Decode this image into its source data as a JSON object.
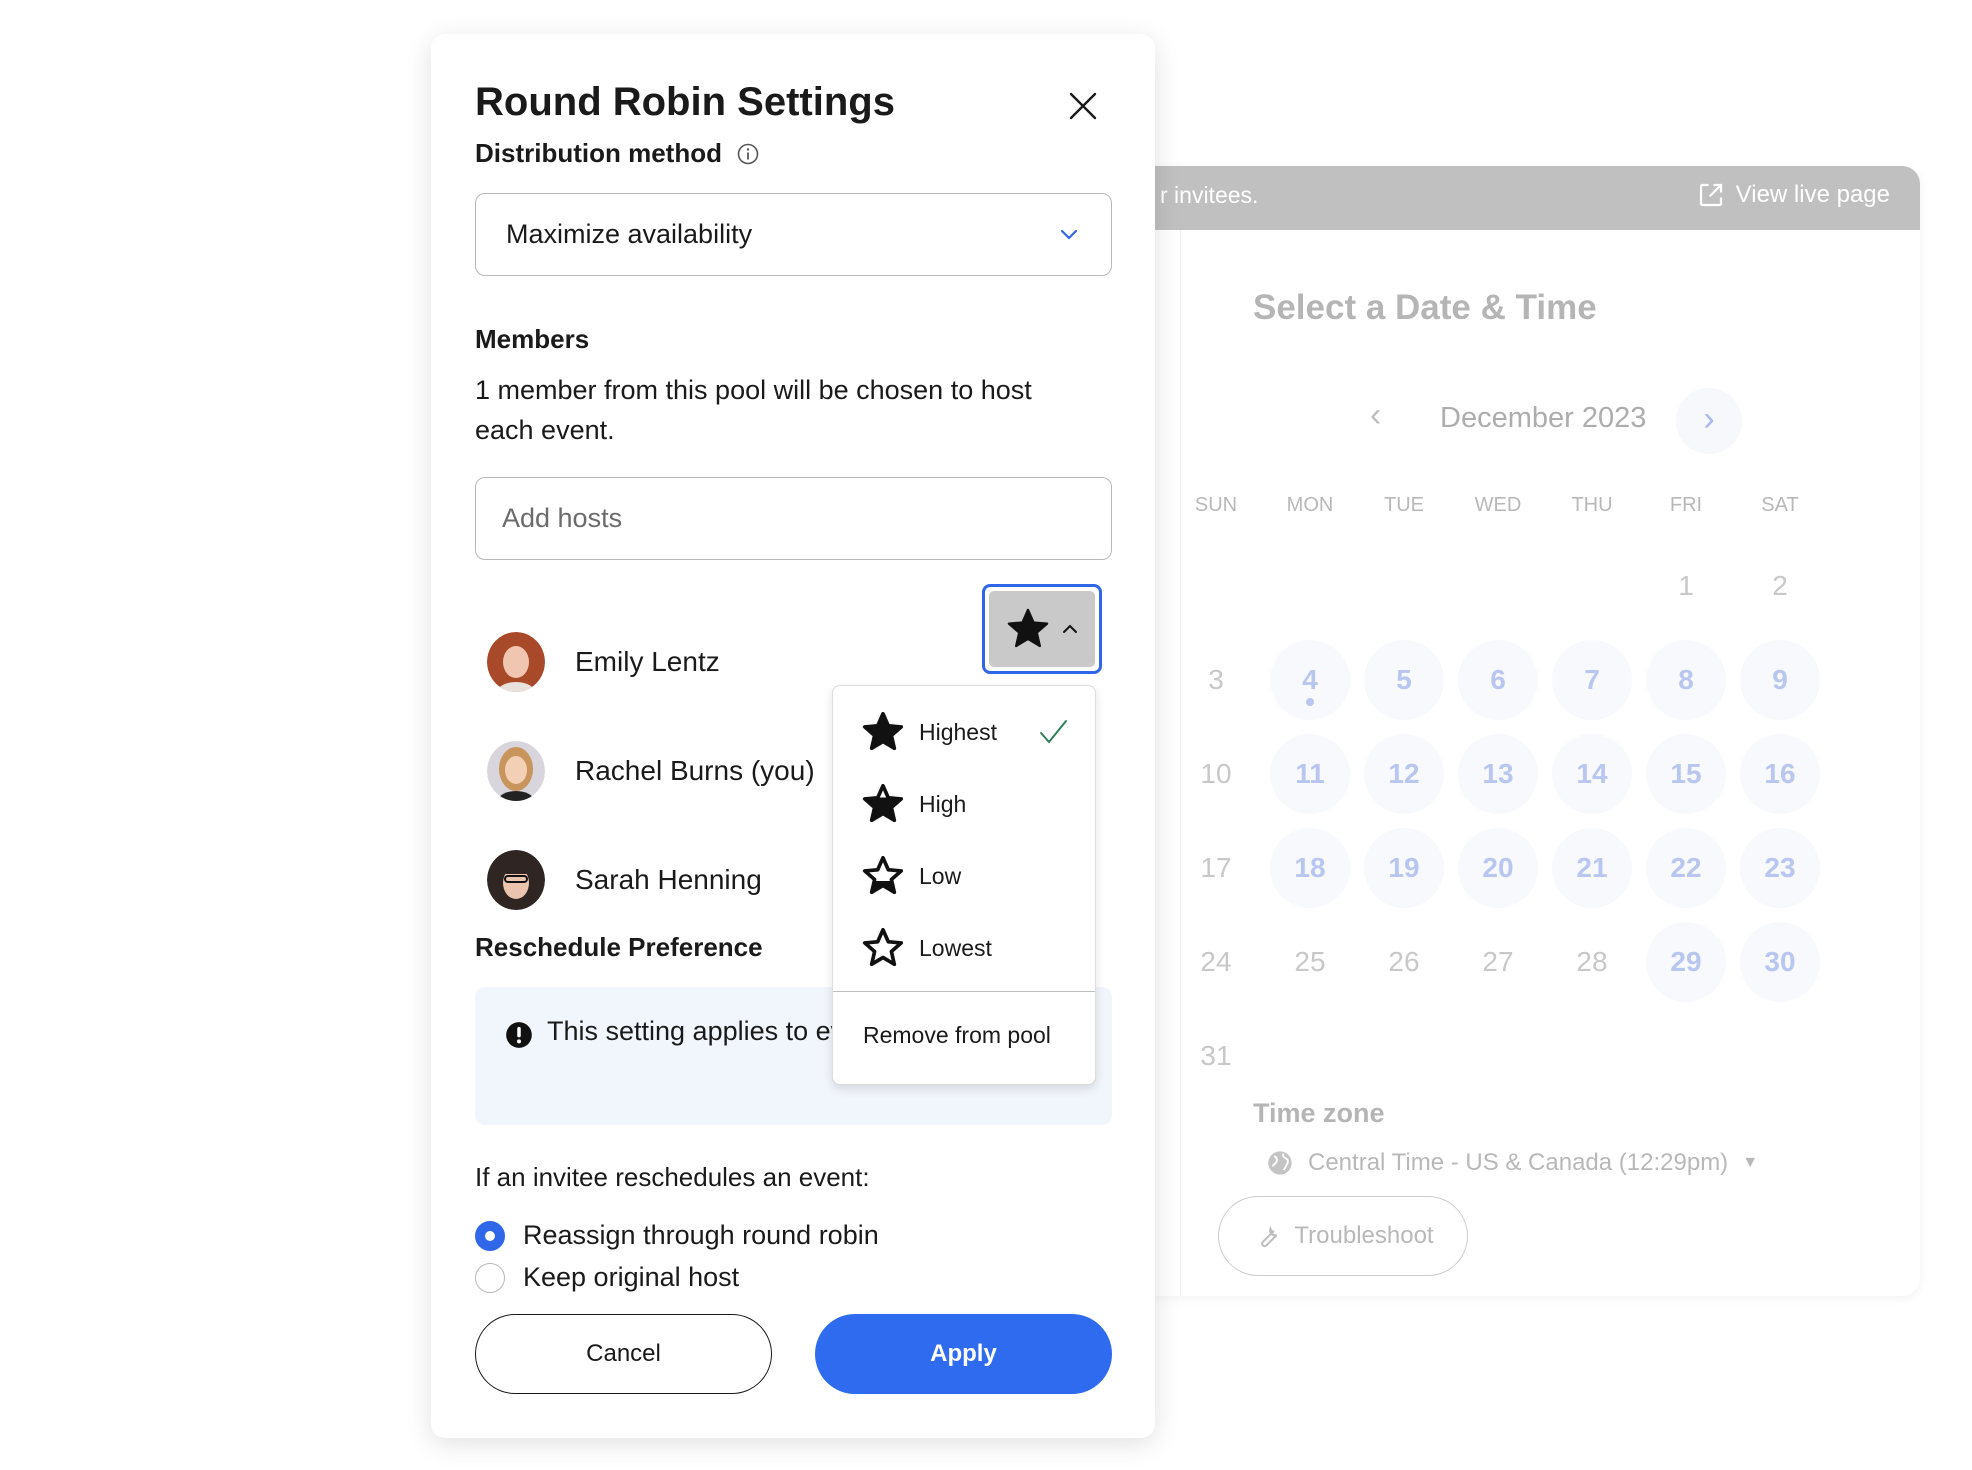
{
  "modal": {
    "title": "Round Robin Settings",
    "distribution_label": "Distribution method",
    "distribution_value": "Maximize availability",
    "members_label": "Members",
    "members_description": "1 member from this pool will be chosen to host each event.",
    "add_hosts_placeholder": "Add hosts",
    "members": [
      {
        "name": "Emily Lentz",
        "avatar_color": "#b5522e"
      },
      {
        "name": "Rachel Burns (you)",
        "avatar_color": "#c99a6a"
      },
      {
        "name": "Sarah Henning",
        "avatar_color": "#3a2e2a"
      }
    ],
    "priority_selected": "Highest",
    "priority_menu": {
      "items": [
        {
          "label": "Highest",
          "fill": 1.0,
          "selected": true
        },
        {
          "label": "High",
          "fill": 0.66,
          "selected": false
        },
        {
          "label": "Low",
          "fill": 0.33,
          "selected": false
        },
        {
          "label": "Lowest",
          "fill": 0.0,
          "selected": false
        }
      ],
      "remove_label": "Remove from pool"
    },
    "reschedule_label": "Reschedule Preference",
    "note_text": "This setting applies to event type",
    "reschedule_question": "If an invitee reschedules an event:",
    "radio_options": [
      {
        "label": "Reassign through round robin",
        "checked": true
      },
      {
        "label": "Keep original host",
        "checked": false
      }
    ],
    "cancel_label": "Cancel",
    "apply_label": "Apply"
  },
  "background": {
    "banner_text": "r invitees.",
    "view_live_label": "View live page",
    "title": "Select a Date & Time",
    "month": "December 2023",
    "weekdays": [
      "SUN",
      "MON",
      "TUE",
      "WED",
      "THU",
      "FRI",
      "SAT"
    ],
    "first_weekday_index": 5,
    "days_in_month": 31,
    "available_days": [
      4,
      5,
      6,
      7,
      8,
      9,
      11,
      12,
      13,
      14,
      15,
      16,
      18,
      19,
      20,
      21,
      22,
      23,
      29,
      30
    ],
    "today_marker_day": 4,
    "timezone_label": "Time zone",
    "timezone_value": "Central Time - US & Canada (12:29pm)",
    "troubleshoot_label": "Troubleshoot"
  },
  "colors": {
    "accent": "#2f6bef",
    "focus_ring": "#2f67e8",
    "check": "#2e7d5b",
    "note_bg": "#f1f6fc"
  }
}
